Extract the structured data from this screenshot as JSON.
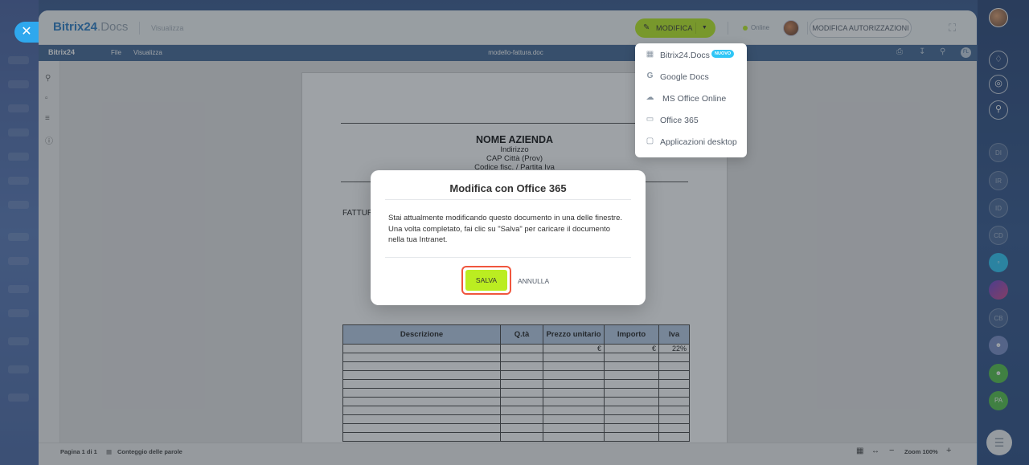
{
  "topbar": {
    "logo_main": "Bitrix24",
    "logo_docs": ".Docs",
    "mode": "Visualizza",
    "edit_label": "MODIFICA",
    "online_label": "Online",
    "permissions_label": "MODIFICA AUTORIZZAZIONI"
  },
  "editor": {
    "logo": "Bitrix24",
    "menu": [
      "File",
      "Visualizza"
    ],
    "filename": "modello-fattura.doc",
    "user_initials": "FL"
  },
  "document": {
    "company_name": "NOME AZIENDA",
    "address": "Indirizzo",
    "city": "CAP Città (Prov)",
    "tax": "Codice fisc. / Partita Iva",
    "invoice_label": "FATTUR",
    "table_headers": [
      "Descrizione",
      "Q.tà",
      "Prezzo unitario",
      "Importo",
      "Iva"
    ],
    "first_row": [
      "",
      "",
      "€",
      "€",
      "22%"
    ]
  },
  "statusbar": {
    "page": "Pagina 1 di 1",
    "word_count": "Conteggio delle parole",
    "zoom": "Zoom 100%"
  },
  "dropdown": {
    "items": [
      {
        "label": "Bitrix24.Docs",
        "icon": "printer-icon",
        "badge": "NUOVO"
      },
      {
        "label": "Google Docs",
        "icon": "google-icon"
      },
      {
        "label": "MS Office Online",
        "icon": "cloud-icon"
      },
      {
        "label": "Office 365",
        "icon": "office-icon"
      },
      {
        "label": "Applicazioni desktop",
        "icon": "monitor-icon"
      }
    ]
  },
  "modal": {
    "title": "Modifica con Office 365",
    "body": "Stai attualmente modificando questo documento in una delle finestre. Una volta completato, fai clic su \"Salva\" per caricare il documento nella tua Intranet.",
    "save_label": "SALVA",
    "cancel_label": "ANNULLA"
  },
  "right_sidebar": {
    "initials": [
      "DI",
      "IR",
      "ID",
      "CD",
      "CB",
      "PA"
    ]
  },
  "colors": {
    "accent_green": "#bbed21",
    "highlight_red": "#f0563e",
    "editor_blue": "#446995"
  }
}
